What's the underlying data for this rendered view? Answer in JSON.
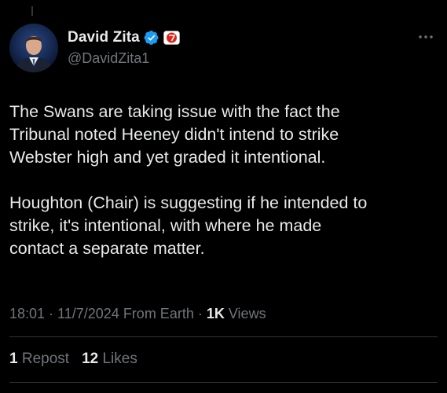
{
  "author": {
    "display_name": "David Zita",
    "handle": "@DavidZita1",
    "verified_icon": "verified-badge-icon",
    "affiliation_icon": "seven-network-logo-icon"
  },
  "tweet": {
    "paragraphs": [
      "The Swans are taking issue with the fact the\nTribunal noted Heeney didn't intend to strike\nWebster high and yet graded it intentional.",
      "Houghton (Chair) is suggesting if he intended to\nstrike, it's intentional, with where he made\ncontact a separate matter."
    ]
  },
  "meta": {
    "time": "18:01",
    "sep1": " · ",
    "date": "11/7/2024",
    "source": "From Earth",
    "sep2": " · ",
    "views_count": "1K",
    "views_label": "Views"
  },
  "stats": {
    "reposts_count": "1",
    "reposts_label": "Repost",
    "likes_count": "12",
    "likes_label": "Likes"
  },
  "colors": {
    "background": "#000000",
    "text": "#e7e9ea",
    "secondary": "#71767b",
    "verified": "#1d9bf0",
    "divider": "#2f3336"
  }
}
